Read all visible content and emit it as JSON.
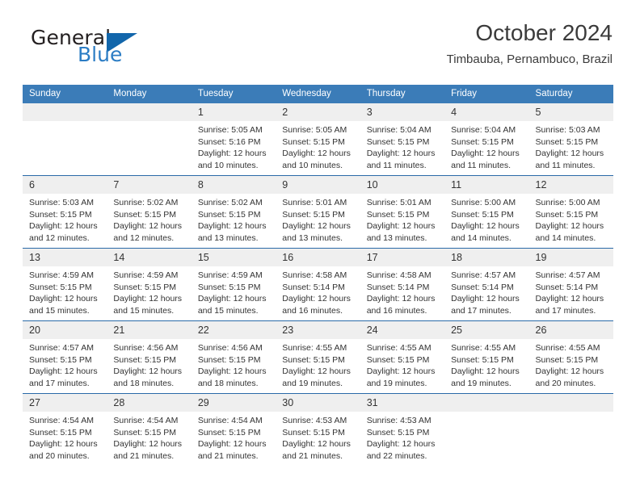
{
  "brand": {
    "name_top": "General",
    "name_bottom": "Blue",
    "logo_icon": "triangle-logo-icon",
    "color_dark": "#231f20",
    "color_blue": "#2b7cc4",
    "color_triangle": "#1266ab"
  },
  "header": {
    "title": "October 2024",
    "subtitle": "Timbauba, Pernambuco, Brazil"
  },
  "theme": {
    "header_bg": "#3b7cb8",
    "row_rule": "#2a6aa8",
    "daynum_bg": "#efefef",
    "text": "#333333"
  },
  "calendar": {
    "weekday_headers": [
      "Sunday",
      "Monday",
      "Tuesday",
      "Wednesday",
      "Thursday",
      "Friday",
      "Saturday"
    ],
    "weeks": [
      [
        {
          "day": "",
          "sunrise": "",
          "sunset": "",
          "daylight_line1": "",
          "daylight_line2": ""
        },
        {
          "day": "",
          "sunrise": "",
          "sunset": "",
          "daylight_line1": "",
          "daylight_line2": ""
        },
        {
          "day": "1",
          "sunrise": "Sunrise: 5:05 AM",
          "sunset": "Sunset: 5:16 PM",
          "daylight_line1": "Daylight: 12 hours",
          "daylight_line2": "and 10 minutes."
        },
        {
          "day": "2",
          "sunrise": "Sunrise: 5:05 AM",
          "sunset": "Sunset: 5:15 PM",
          "daylight_line1": "Daylight: 12 hours",
          "daylight_line2": "and 10 minutes."
        },
        {
          "day": "3",
          "sunrise": "Sunrise: 5:04 AM",
          "sunset": "Sunset: 5:15 PM",
          "daylight_line1": "Daylight: 12 hours",
          "daylight_line2": "and 11 minutes."
        },
        {
          "day": "4",
          "sunrise": "Sunrise: 5:04 AM",
          "sunset": "Sunset: 5:15 PM",
          "daylight_line1": "Daylight: 12 hours",
          "daylight_line2": "and 11 minutes."
        },
        {
          "day": "5",
          "sunrise": "Sunrise: 5:03 AM",
          "sunset": "Sunset: 5:15 PM",
          "daylight_line1": "Daylight: 12 hours",
          "daylight_line2": "and 11 minutes."
        }
      ],
      [
        {
          "day": "6",
          "sunrise": "Sunrise: 5:03 AM",
          "sunset": "Sunset: 5:15 PM",
          "daylight_line1": "Daylight: 12 hours",
          "daylight_line2": "and 12 minutes."
        },
        {
          "day": "7",
          "sunrise": "Sunrise: 5:02 AM",
          "sunset": "Sunset: 5:15 PM",
          "daylight_line1": "Daylight: 12 hours",
          "daylight_line2": "and 12 minutes."
        },
        {
          "day": "8",
          "sunrise": "Sunrise: 5:02 AM",
          "sunset": "Sunset: 5:15 PM",
          "daylight_line1": "Daylight: 12 hours",
          "daylight_line2": "and 13 minutes."
        },
        {
          "day": "9",
          "sunrise": "Sunrise: 5:01 AM",
          "sunset": "Sunset: 5:15 PM",
          "daylight_line1": "Daylight: 12 hours",
          "daylight_line2": "and 13 minutes."
        },
        {
          "day": "10",
          "sunrise": "Sunrise: 5:01 AM",
          "sunset": "Sunset: 5:15 PM",
          "daylight_line1": "Daylight: 12 hours",
          "daylight_line2": "and 13 minutes."
        },
        {
          "day": "11",
          "sunrise": "Sunrise: 5:00 AM",
          "sunset": "Sunset: 5:15 PM",
          "daylight_line1": "Daylight: 12 hours",
          "daylight_line2": "and 14 minutes."
        },
        {
          "day": "12",
          "sunrise": "Sunrise: 5:00 AM",
          "sunset": "Sunset: 5:15 PM",
          "daylight_line1": "Daylight: 12 hours",
          "daylight_line2": "and 14 minutes."
        }
      ],
      [
        {
          "day": "13",
          "sunrise": "Sunrise: 4:59 AM",
          "sunset": "Sunset: 5:15 PM",
          "daylight_line1": "Daylight: 12 hours",
          "daylight_line2": "and 15 minutes."
        },
        {
          "day": "14",
          "sunrise": "Sunrise: 4:59 AM",
          "sunset": "Sunset: 5:15 PM",
          "daylight_line1": "Daylight: 12 hours",
          "daylight_line2": "and 15 minutes."
        },
        {
          "day": "15",
          "sunrise": "Sunrise: 4:59 AM",
          "sunset": "Sunset: 5:15 PM",
          "daylight_line1": "Daylight: 12 hours",
          "daylight_line2": "and 15 minutes."
        },
        {
          "day": "16",
          "sunrise": "Sunrise: 4:58 AM",
          "sunset": "Sunset: 5:14 PM",
          "daylight_line1": "Daylight: 12 hours",
          "daylight_line2": "and 16 minutes."
        },
        {
          "day": "17",
          "sunrise": "Sunrise: 4:58 AM",
          "sunset": "Sunset: 5:14 PM",
          "daylight_line1": "Daylight: 12 hours",
          "daylight_line2": "and 16 minutes."
        },
        {
          "day": "18",
          "sunrise": "Sunrise: 4:57 AM",
          "sunset": "Sunset: 5:14 PM",
          "daylight_line1": "Daylight: 12 hours",
          "daylight_line2": "and 17 minutes."
        },
        {
          "day": "19",
          "sunrise": "Sunrise: 4:57 AM",
          "sunset": "Sunset: 5:14 PM",
          "daylight_line1": "Daylight: 12 hours",
          "daylight_line2": "and 17 minutes."
        }
      ],
      [
        {
          "day": "20",
          "sunrise": "Sunrise: 4:57 AM",
          "sunset": "Sunset: 5:15 PM",
          "daylight_line1": "Daylight: 12 hours",
          "daylight_line2": "and 17 minutes."
        },
        {
          "day": "21",
          "sunrise": "Sunrise: 4:56 AM",
          "sunset": "Sunset: 5:15 PM",
          "daylight_line1": "Daylight: 12 hours",
          "daylight_line2": "and 18 minutes."
        },
        {
          "day": "22",
          "sunrise": "Sunrise: 4:56 AM",
          "sunset": "Sunset: 5:15 PM",
          "daylight_line1": "Daylight: 12 hours",
          "daylight_line2": "and 18 minutes."
        },
        {
          "day": "23",
          "sunrise": "Sunrise: 4:55 AM",
          "sunset": "Sunset: 5:15 PM",
          "daylight_line1": "Daylight: 12 hours",
          "daylight_line2": "and 19 minutes."
        },
        {
          "day": "24",
          "sunrise": "Sunrise: 4:55 AM",
          "sunset": "Sunset: 5:15 PM",
          "daylight_line1": "Daylight: 12 hours",
          "daylight_line2": "and 19 minutes."
        },
        {
          "day": "25",
          "sunrise": "Sunrise: 4:55 AM",
          "sunset": "Sunset: 5:15 PM",
          "daylight_line1": "Daylight: 12 hours",
          "daylight_line2": "and 19 minutes."
        },
        {
          "day": "26",
          "sunrise": "Sunrise: 4:55 AM",
          "sunset": "Sunset: 5:15 PM",
          "daylight_line1": "Daylight: 12 hours",
          "daylight_line2": "and 20 minutes."
        }
      ],
      [
        {
          "day": "27",
          "sunrise": "Sunrise: 4:54 AM",
          "sunset": "Sunset: 5:15 PM",
          "daylight_line1": "Daylight: 12 hours",
          "daylight_line2": "and 20 minutes."
        },
        {
          "day": "28",
          "sunrise": "Sunrise: 4:54 AM",
          "sunset": "Sunset: 5:15 PM",
          "daylight_line1": "Daylight: 12 hours",
          "daylight_line2": "and 21 minutes."
        },
        {
          "day": "29",
          "sunrise": "Sunrise: 4:54 AM",
          "sunset": "Sunset: 5:15 PM",
          "daylight_line1": "Daylight: 12 hours",
          "daylight_line2": "and 21 minutes."
        },
        {
          "day": "30",
          "sunrise": "Sunrise: 4:53 AM",
          "sunset": "Sunset: 5:15 PM",
          "daylight_line1": "Daylight: 12 hours",
          "daylight_line2": "and 21 minutes."
        },
        {
          "day": "31",
          "sunrise": "Sunrise: 4:53 AM",
          "sunset": "Sunset: 5:15 PM",
          "daylight_line1": "Daylight: 12 hours",
          "daylight_line2": "and 22 minutes."
        },
        {
          "day": "",
          "sunrise": "",
          "sunset": "",
          "daylight_line1": "",
          "daylight_line2": ""
        },
        {
          "day": "",
          "sunrise": "",
          "sunset": "",
          "daylight_line1": "",
          "daylight_line2": ""
        }
      ]
    ]
  }
}
